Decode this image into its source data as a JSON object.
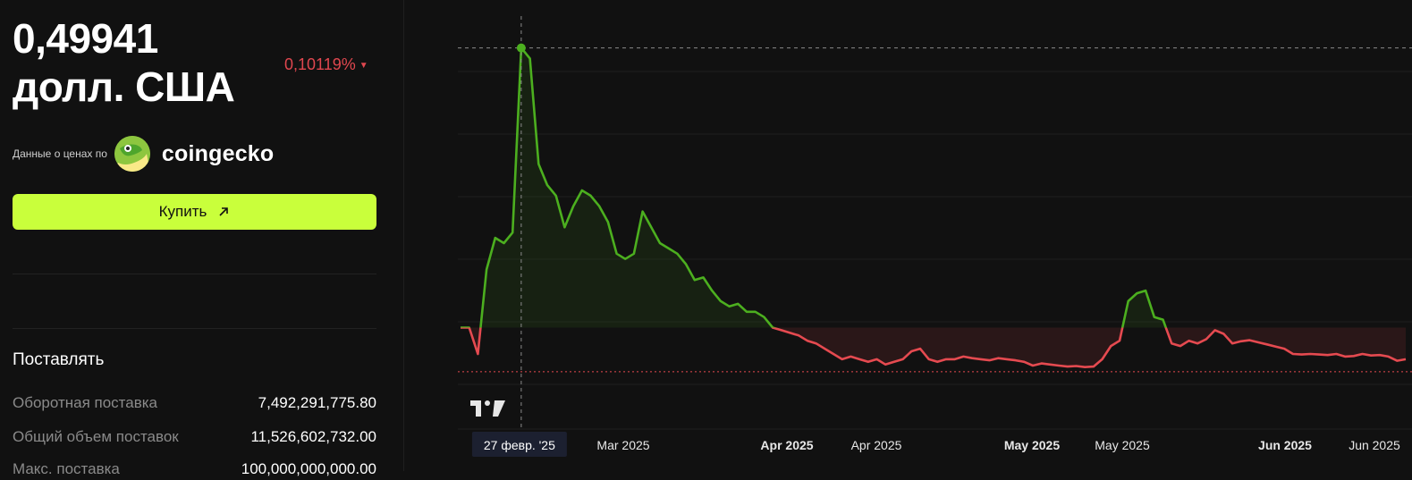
{
  "price": {
    "value": "0,49941",
    "currency": "долл. США"
  },
  "change": {
    "value": "0,10119%",
    "direction": "down",
    "color": "#e0474f"
  },
  "credit": {
    "prefix": "Данные о ценах по",
    "brand": "coingecko"
  },
  "buy_button": {
    "label": "Купить",
    "color": "#c9ff3b"
  },
  "supply": {
    "title": "Поставлять",
    "rows": [
      {
        "label": "Оборотная поставка",
        "value": "7,492,291,775.80"
      },
      {
        "label": "Общий объем поставок",
        "value": "11,526,602,732.00"
      },
      {
        "label": "Макс. поставка",
        "value": "100,000,000,000.00"
      }
    ]
  },
  "chart_data": {
    "type": "line",
    "baseline_colors": {
      "above": "#4caf1f",
      "below": "#e54a50"
    },
    "crosshair_label": "27 февр. '25",
    "x_ticks": [
      {
        "label": "Mar 2025",
        "bold": false
      },
      {
        "label": "Apr 2025",
        "bold": true
      },
      {
        "label": "Apr 2025",
        "bold": false
      },
      {
        "label": "May 2025",
        "bold": true
      },
      {
        "label": "May 2025",
        "bold": false
      },
      {
        "label": "Jun 2025",
        "bold": true
      },
      {
        "label": "Jun 2025",
        "bold": false
      }
    ],
    "grid": true,
    "values": [
      0.55,
      0.55,
      0.5,
      0.66,
      0.72,
      0.71,
      0.73,
      1.08,
      1.06,
      0.86,
      0.82,
      0.8,
      0.74,
      0.78,
      0.81,
      0.8,
      0.78,
      0.75,
      0.69,
      0.68,
      0.69,
      0.77,
      0.74,
      0.71,
      0.7,
      0.69,
      0.67,
      0.64,
      0.645,
      0.62,
      0.6,
      0.59,
      0.595,
      0.58,
      0.58,
      0.57,
      0.55,
      0.545,
      0.54,
      0.535,
      0.525,
      0.52,
      0.51,
      0.5,
      0.49,
      0.495,
      0.49,
      0.485,
      0.49,
      0.48,
      0.485,
      0.49,
      0.505,
      0.51,
      0.49,
      0.485,
      0.49,
      0.49,
      0.495,
      0.492,
      0.49,
      0.488,
      0.492,
      0.49,
      0.488,
      0.485,
      0.478,
      0.482,
      0.48,
      0.478,
      0.476,
      0.477,
      0.475,
      0.476,
      0.49,
      0.515,
      0.525,
      0.6,
      0.615,
      0.62,
      0.57,
      0.565,
      0.52,
      0.515,
      0.525,
      0.52,
      0.528,
      0.545,
      0.538,
      0.52,
      0.524,
      0.526,
      0.522,
      0.518,
      0.514,
      0.51,
      0.5,
      0.499,
      0.5,
      0.499,
      0.498,
      0.5,
      0.495,
      0.496,
      0.5,
      0.497,
      0.498,
      0.495,
      0.487,
      0.49
    ]
  }
}
